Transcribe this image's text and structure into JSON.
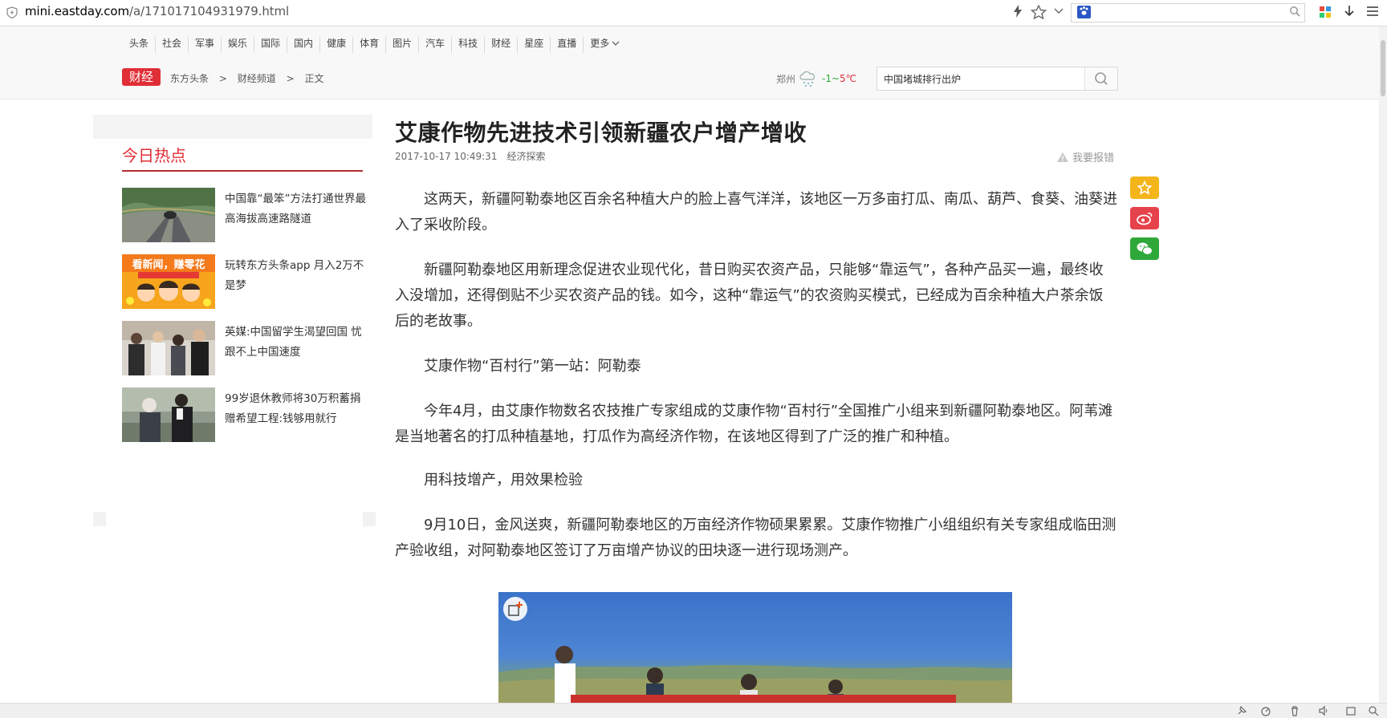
{
  "browser": {
    "url_domain": "mini.eastday.com",
    "url_path": "/a/171017104931979.html"
  },
  "nav": {
    "items": [
      "头条",
      "社会",
      "军事",
      "娱乐",
      "国际",
      "国内",
      "健康",
      "体育",
      "图片",
      "汽车",
      "科技",
      "财经",
      "星座",
      "直播",
      "更多"
    ]
  },
  "breadcrumb": {
    "badge": "财经",
    "items": [
      "东方头条",
      ">",
      "财经频道",
      ">",
      "正文"
    ]
  },
  "weather": {
    "city": "郑州",
    "temp_low": "-1",
    "sep": "~",
    "temp_high": "5℃"
  },
  "search": {
    "value": "中国堵城排行出炉"
  },
  "sidebar": {
    "title": "今日热点",
    "items": [
      {
        "text": "中国靠“最笨”方法打通世界最高海拔高速路隧道"
      },
      {
        "text": "玩转东方头条app 月入2万不是梦"
      },
      {
        "text": "英媒:中国留学生渴望回国 忧跟不上中国速度"
      },
      {
        "text": "99岁退休教师将30万积蓄捐赠希望工程:钱够用就行"
      }
    ],
    "ad_banner_text": "看新闻，赚零花"
  },
  "article": {
    "title": "艾康作物先进技术引领新疆农户增产增收",
    "datetime": "2017-10-17 10:49:31",
    "source": "经济探索",
    "report": "我要报错",
    "paragraphs": [
      "这两天，新疆阿勒泰地区百余名种植大户的脸上喜气洋洋，该地区一万多亩打瓜、南瓜、葫芦、食葵、油葵进入了采收阶段。",
      "新疆阿勒泰地区用新理念促进农业现代化，昔日购买农资产品，只能够“靠运气”，各种产品买一遍，最终收入没增加，还得倒贴不少买农资产品的钱。如今，这种“靠运气”的农资购买模式，已经成为百余种植大户茶余饭后的老故事。",
      "艾康作物“百村行”第一站：阿勒泰",
      "今年4月，由艾康作物数名农技推广专家组成的艾康作物“百村行”全国推广小组来到新疆阿勒泰地区。阿苇滩是当地著名的打瓜种植基地，打瓜作为高经济作物，在该地区得到了广泛的推广和种植。",
      "用科技增产，用效果检验",
      "9月10日，金风送爽，新疆阿勒泰地区的万亩经济作物硕果累累。艾康作物推广小组组织有关专家组成临田测产验收组，对阿勒泰地区签订了万亩增产协议的田块逐一进行现场测产。"
    ]
  }
}
